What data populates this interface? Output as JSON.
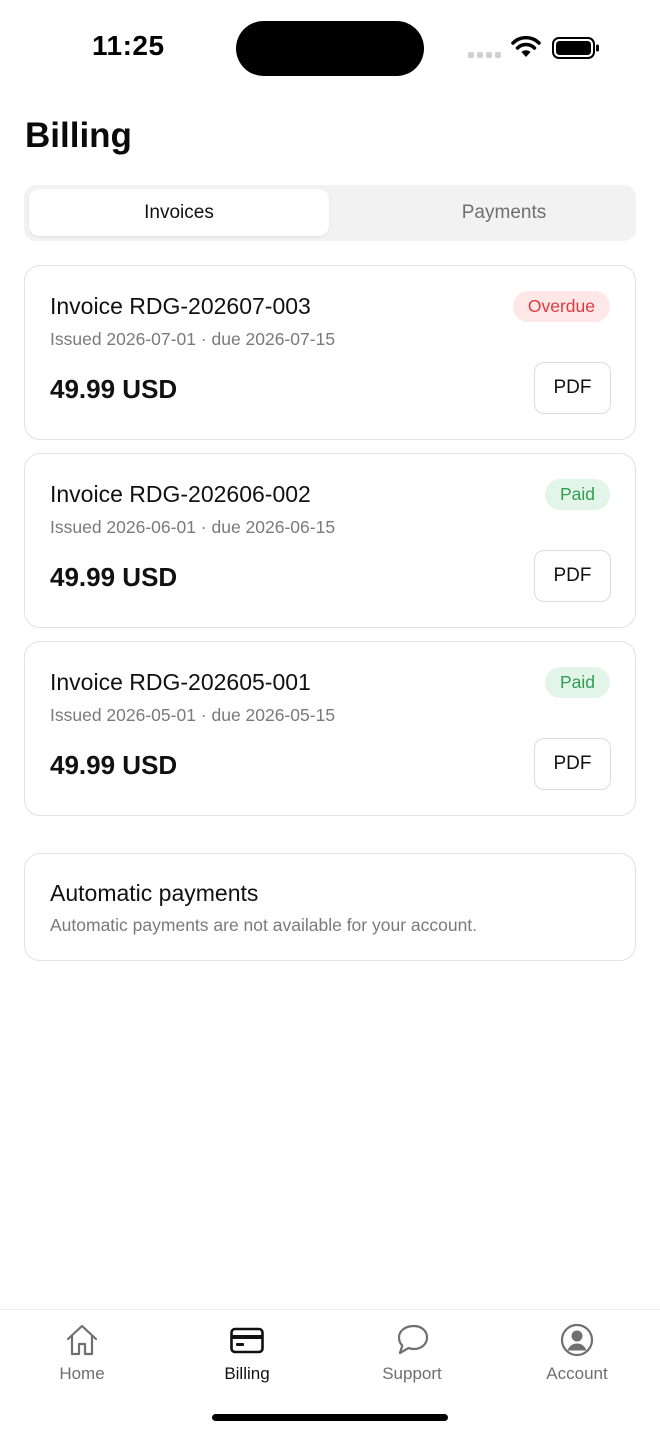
{
  "status_bar": {
    "time": "11:25"
  },
  "page": {
    "title": "Billing"
  },
  "segments": {
    "invoices": "Invoices",
    "payments": "Payments",
    "selected": "Invoices"
  },
  "invoices": [
    {
      "title": "Invoice RDG-202607-003",
      "meta": "Issued 2026-07-01 · due 2026-07-15",
      "amount": "49.99 USD",
      "status": "Overdue",
      "button": "PDF"
    },
    {
      "title": "Invoice RDG-202606-002",
      "meta": "Issued 2026-06-01 · due 2026-06-15",
      "amount": "49.99 USD",
      "status": "Paid",
      "button": "PDF"
    },
    {
      "title": "Invoice RDG-202605-001",
      "meta": "Issued 2026-05-01 · due 2026-05-15",
      "amount": "49.99 USD",
      "status": "Paid",
      "button": "PDF"
    }
  ],
  "automatic_payments": {
    "title": "Automatic payments",
    "description": "Automatic payments are not available for your account."
  },
  "tab_bar": {
    "home": "Home",
    "billing": "Billing",
    "support": "Support",
    "account": "Account",
    "active": "Billing"
  },
  "colors": {
    "overdue_text": "#e0393f",
    "overdue_bg": "#fde7e7",
    "paid_text": "#2f9e4f",
    "paid_bg": "#e3f5e9"
  },
  "icons": {
    "home": "home-icon",
    "billing": "credit-card-icon",
    "support": "chat-bubble-icon",
    "account": "user-circle-icon"
  }
}
